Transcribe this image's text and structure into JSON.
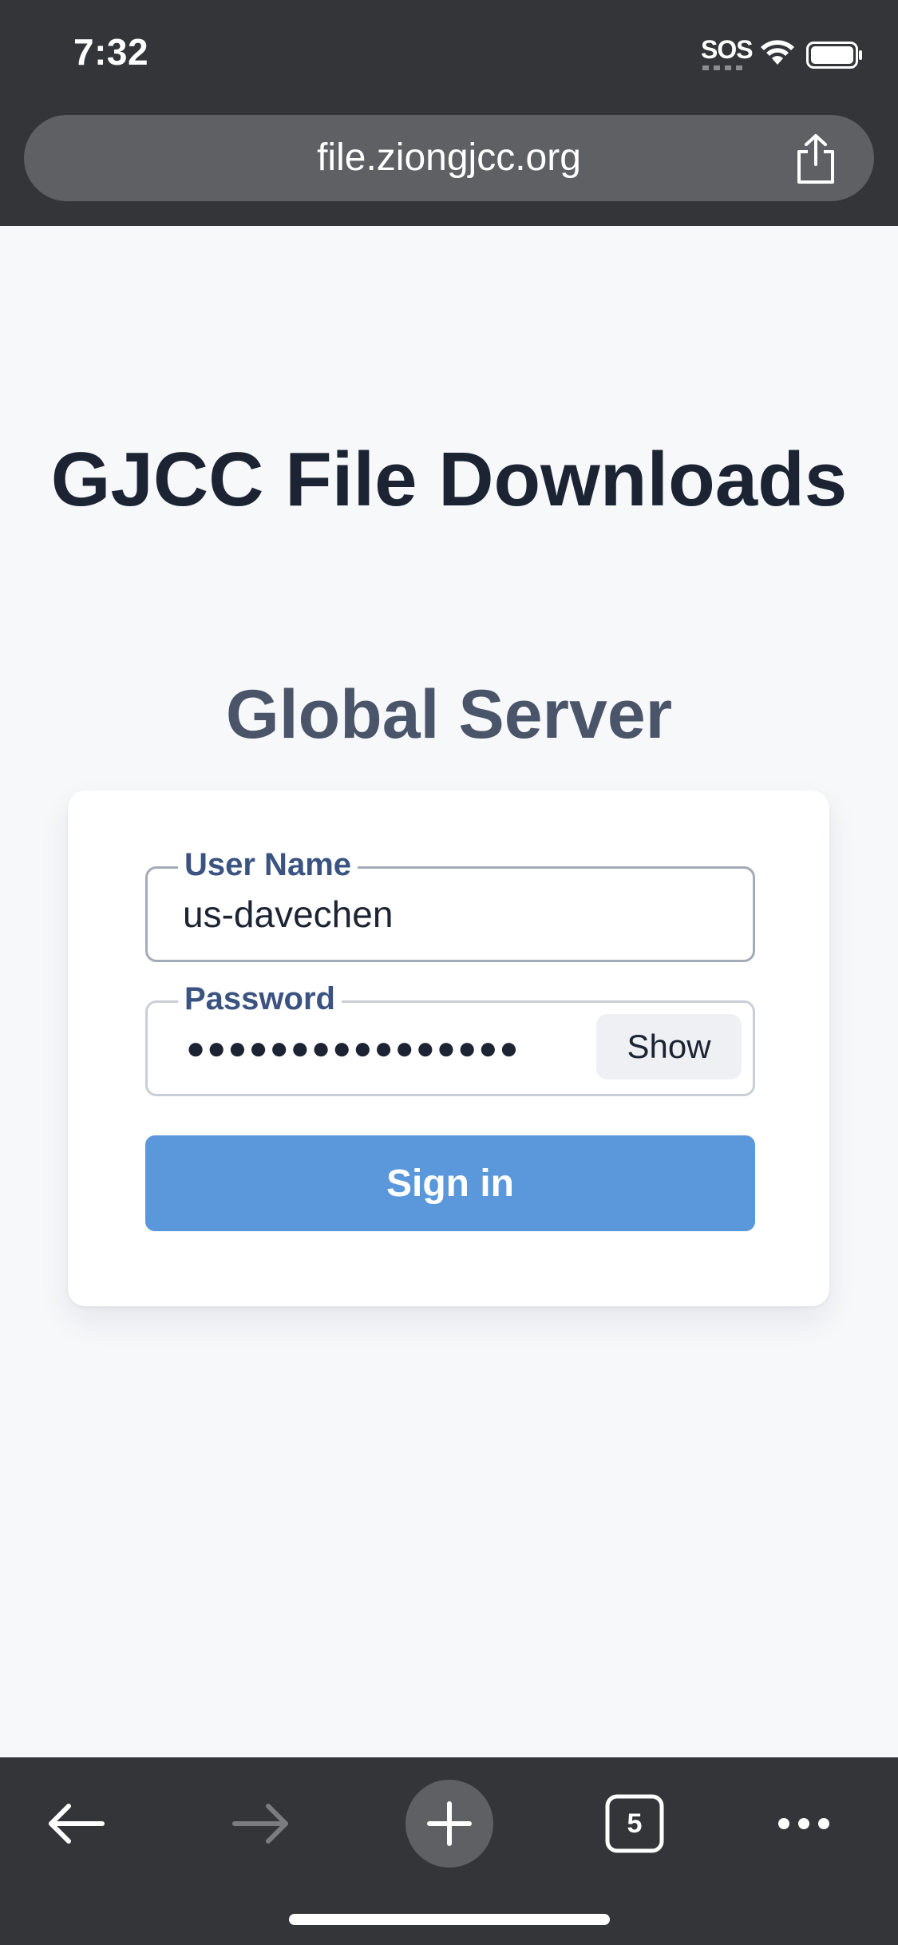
{
  "status_bar": {
    "time": "7:32",
    "sos": "SOS",
    "icons": [
      "wifi-icon",
      "battery-icon"
    ]
  },
  "browser": {
    "url": "file.ziongjcc.org",
    "tabs_count": "5",
    "icons": [
      "share-icon",
      "back-arrow-icon",
      "forward-arrow-icon",
      "plus-icon",
      "tabs-icon",
      "more-icon"
    ]
  },
  "page": {
    "title": "GJCC File Downloads",
    "subtitle": "Global Server"
  },
  "login": {
    "username_label": "User Name",
    "username_value": "us-davechen",
    "password_label": "Password",
    "password_masked": "●●●●●●●●●●●●●●●●",
    "show_label": "Show",
    "signin_label": "Sign in"
  },
  "colors": {
    "chrome_bg": "#343538",
    "url_bar_bg": "#5f6064",
    "page_bg": "#f7f8fa",
    "title_color": "#1c2433",
    "subtitle_color": "#4a5569",
    "label_color": "#3a5380",
    "signin_bg": "#5b98db"
  }
}
